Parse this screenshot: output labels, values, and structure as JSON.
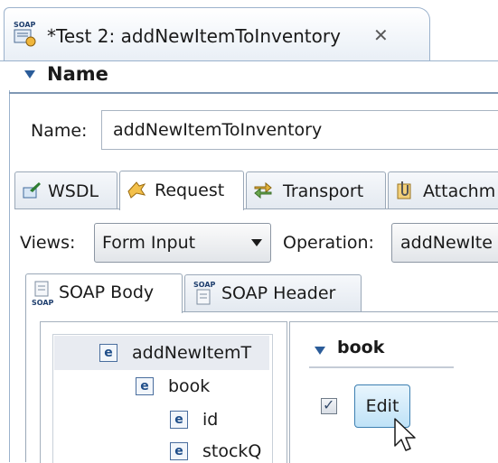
{
  "editor_tab": {
    "icon_text": "SOAP",
    "title": "*Test 2: addNewItemToInventory",
    "close_glyph": "✕"
  },
  "name_section": {
    "header": "Name",
    "label": "Name:",
    "value": "addNewItemToInventory"
  },
  "main_tabs": [
    {
      "label": "WSDL",
      "icon": "wsdl-icon"
    },
    {
      "label": "Request",
      "icon": "request-icon",
      "selected": true
    },
    {
      "label": "Transport",
      "icon": "transport-icon"
    },
    {
      "label": "Attachm",
      "icon": "attachment-icon"
    }
  ],
  "views": {
    "label": "Views:",
    "value": "Form Input"
  },
  "operation": {
    "label": "Operation:",
    "value": "addNewIte"
  },
  "soap_tabs": [
    {
      "label": "SOAP Body",
      "icon": "soap-body-icon",
      "selected": true
    },
    {
      "label": "SOAP Header",
      "icon": "soap-header-icon"
    }
  ],
  "tree": {
    "element_icon_text": "e",
    "items": [
      {
        "label": "addNewItemT",
        "level": 0,
        "selected": true
      },
      {
        "label": "book",
        "level": 1
      },
      {
        "label": "id",
        "level": 2
      },
      {
        "label": "stockQ",
        "level": 2
      }
    ]
  },
  "form": {
    "section_header": "book",
    "checkbox_checked": true,
    "edit_button_label": "Edit"
  },
  "colors": {
    "accent_blue": "#2b5c99",
    "border": "#9bb2cc",
    "selection": "#e8ebf1",
    "edit_button": "#bfe2f7"
  }
}
